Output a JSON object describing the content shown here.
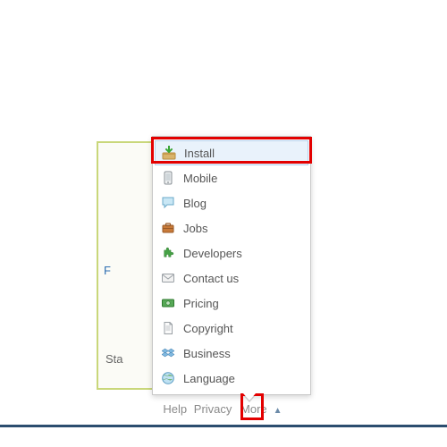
{
  "background": {
    "blue_text_fragment": "F",
    "gray_text_fragment": "Sta"
  },
  "footer": {
    "help": "Help",
    "privacy": "Privacy",
    "more": "More",
    "caret": "▲"
  },
  "menu": {
    "items": [
      {
        "key": "install",
        "label": "Install",
        "icon": "download-box-icon",
        "selected": true
      },
      {
        "key": "mobile",
        "label": "Mobile",
        "icon": "mobile-icon"
      },
      {
        "key": "blog",
        "label": "Blog",
        "icon": "speech-bubble-icon"
      },
      {
        "key": "jobs",
        "label": "Jobs",
        "icon": "briefcase-icon"
      },
      {
        "key": "developers",
        "label": "Developers",
        "icon": "puzzle-piece-icon"
      },
      {
        "key": "contact",
        "label": "Contact us",
        "icon": "envelope-icon"
      },
      {
        "key": "pricing",
        "label": "Pricing",
        "icon": "money-icon"
      },
      {
        "key": "copyright",
        "label": "Copyright",
        "icon": "document-icon"
      },
      {
        "key": "business",
        "label": "Business",
        "icon": "dropbox-icon"
      },
      {
        "key": "language",
        "label": "Language",
        "icon": "globe-icon"
      }
    ]
  },
  "annotations": {
    "highlight_install": true,
    "highlight_more_caret": true
  }
}
